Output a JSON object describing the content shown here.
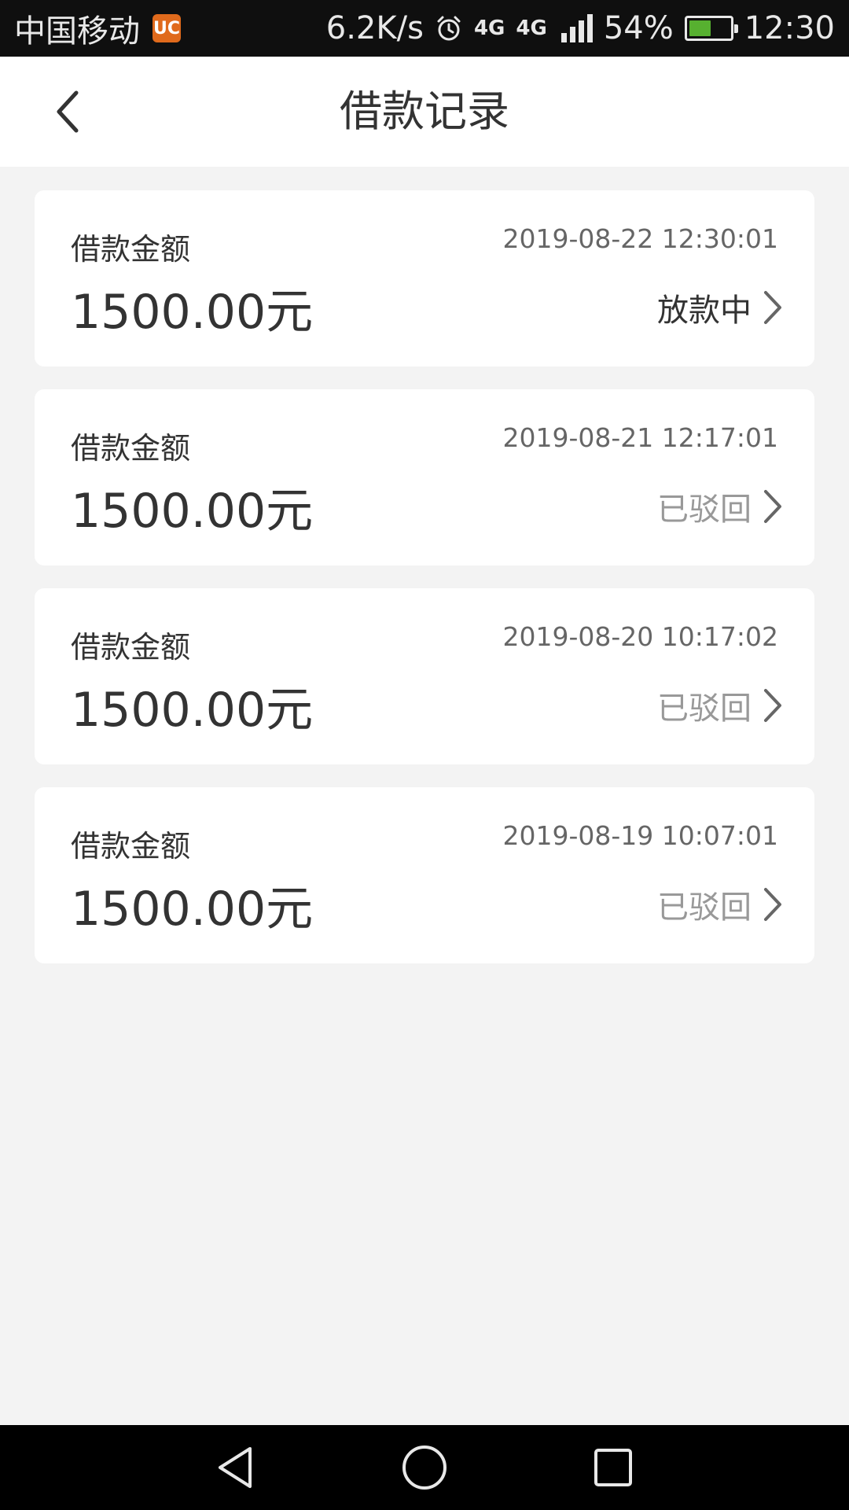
{
  "status_bar": {
    "carrier": "中国移动",
    "uc_icon_glyph": "UC",
    "net_speed": "6.2K/s",
    "net_type_1": "4G",
    "net_type_2": "4G",
    "battery_percent": "54%",
    "battery_level": 0.54,
    "time": "12:30"
  },
  "header": {
    "title": "借款记录"
  },
  "records": [
    {
      "label": "借款金额",
      "amount": "1500.00元",
      "date": "2019-08-22 12:30:01",
      "status": "放款中"
    },
    {
      "label": "借款金额",
      "amount": "1500.00元",
      "date": "2019-08-21 12:17:01",
      "status": "已驳回"
    },
    {
      "label": "借款金额",
      "amount": "1500.00元",
      "date": "2019-08-20 10:17:02",
      "status": "已驳回"
    },
    {
      "label": "借款金额",
      "amount": "1500.00元",
      "date": "2019-08-19 10:07:01",
      "status": "已驳回"
    }
  ],
  "colors": {
    "background": "#f3f3f3",
    "card": "#ffffff",
    "status_active": "#333333",
    "status_rejected": "#999999"
  },
  "icons": {
    "back": "chevron-left-icon",
    "row_arrow": "chevron-right-icon",
    "alarm": "alarm-icon",
    "signal": "signal-icon",
    "battery": "battery-icon",
    "nav_back": "triangle-back-icon",
    "nav_home": "circle-home-icon",
    "nav_recent": "square-recent-icon"
  }
}
